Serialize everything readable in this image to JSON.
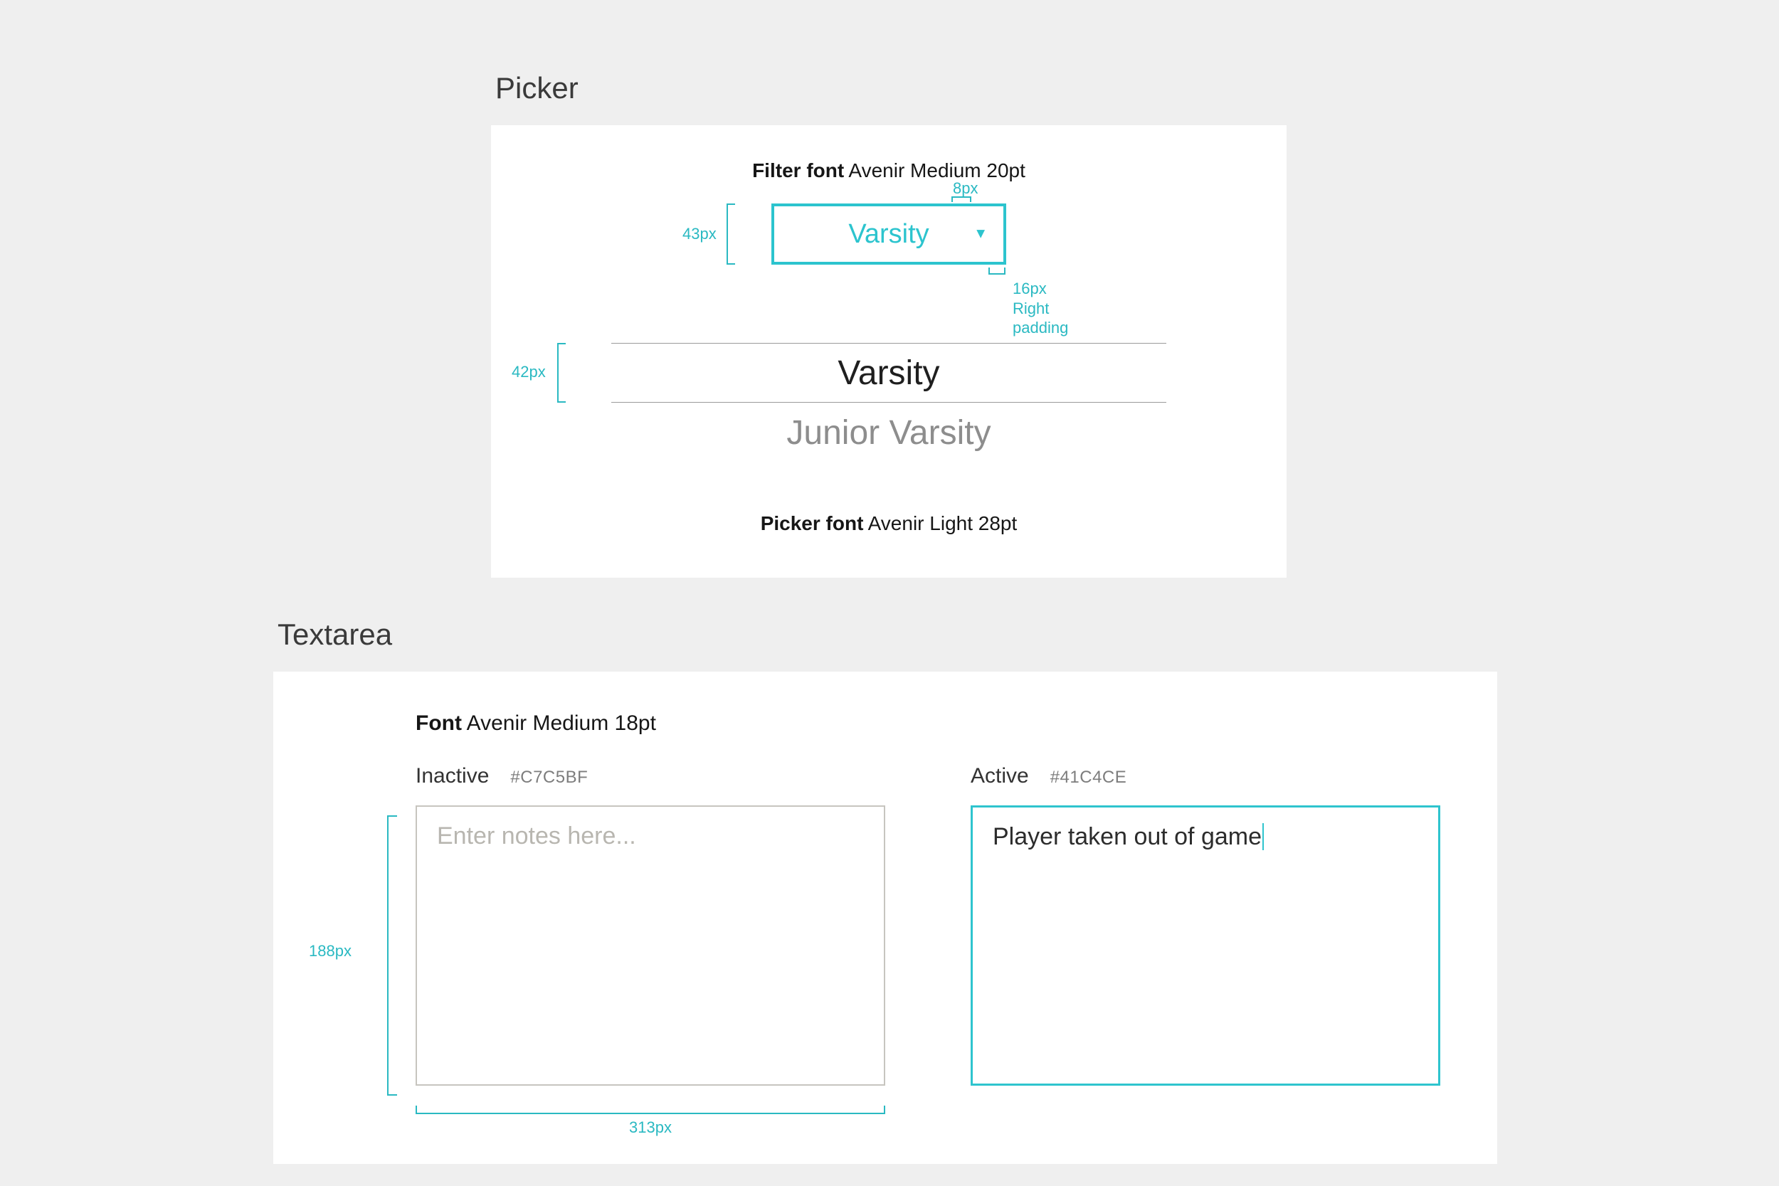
{
  "picker": {
    "title": "Picker",
    "filter_font_label": "Filter font",
    "filter_font_value": "Avenir Medium 20pt",
    "dropdown_value": "Varsity",
    "dim_8px": "8px",
    "dim_43px": "43px",
    "dim_16px": "16px\nRight\npadding",
    "dim_42px": "42px",
    "wheel_selected": "Varsity",
    "wheel_next": "Junior Varsity",
    "picker_font_label": "Picker font",
    "picker_font_value": "Avenir Light 28pt"
  },
  "textarea": {
    "title": "Textarea",
    "font_label": "Font",
    "font_value": "Avenir Medium 18pt",
    "inactive_label": "Inactive",
    "inactive_hex": "#C7C5BF",
    "inactive_placeholder": "Enter notes here...",
    "active_label": "Active",
    "active_hex": "#41C4CE",
    "active_text": "Player taken out of game",
    "dim_188px": "188px",
    "dim_313px": "313px"
  }
}
